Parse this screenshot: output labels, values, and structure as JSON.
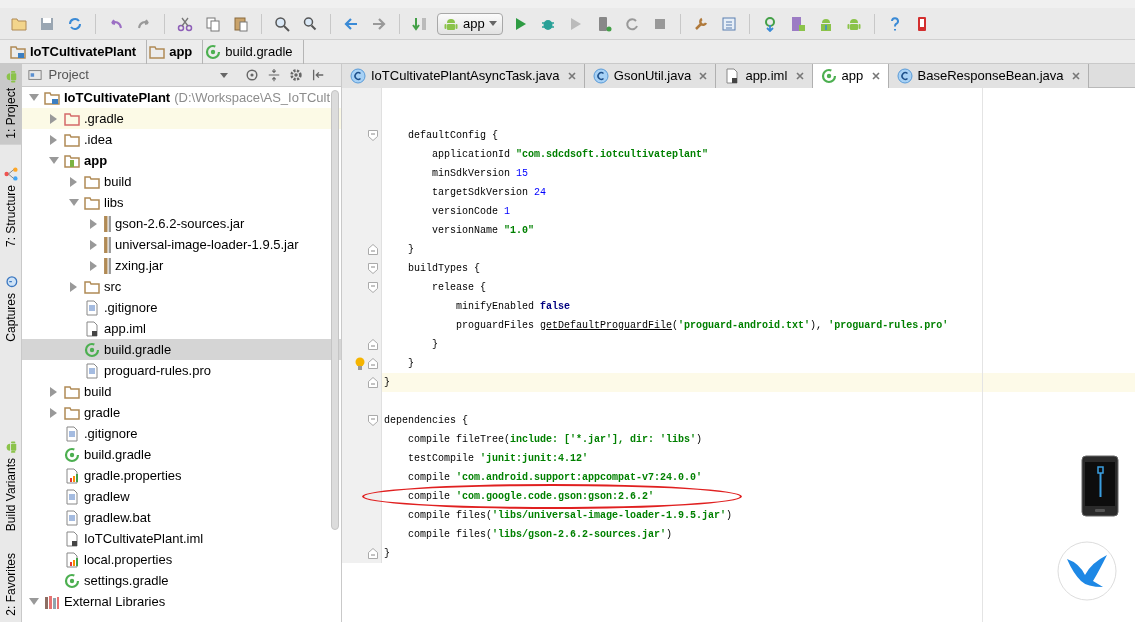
{
  "run_config": {
    "label": "app"
  },
  "breadcrumbs": [
    {
      "label": "IoTCultivatePlant",
      "kind": "project-folder",
      "bold": true
    },
    {
      "label": "app",
      "kind": "folder",
      "bold": true
    },
    {
      "label": "build.gradle",
      "kind": "gradle",
      "bold": false
    }
  ],
  "tool_windows": {
    "top": [
      {
        "label": "1: Project",
        "kind": "android",
        "selected": true
      },
      {
        "label": "7: Structure",
        "kind": "structure",
        "selected": false
      },
      {
        "label": "Captures",
        "kind": "stopwatch",
        "selected": false
      }
    ],
    "bottom": [
      {
        "label": "Build Variants",
        "kind": "android",
        "selected": false
      },
      {
        "label": "2: Favorites",
        "kind": "plain",
        "selected": false
      }
    ]
  },
  "project_panel": {
    "title": "Project",
    "tree": [
      {
        "label": "IoTCultivatePlant",
        "hint": "(D:\\Workspace\\AS_IoTCult",
        "kind": "project-folder",
        "bold": true,
        "expanded": true,
        "selected": false,
        "highlighted": false,
        "children": [
          {
            "label": ".gradle",
            "kind": "folder-excluded",
            "bold": false,
            "expanded": false,
            "selected": false,
            "highlighted": true
          },
          {
            "label": ".idea",
            "kind": "folder",
            "bold": false,
            "expanded": false,
            "selected": false,
            "highlighted": false
          },
          {
            "label": "app",
            "kind": "module-folder",
            "bold": true,
            "expanded": true,
            "selected": false,
            "highlighted": false,
            "children": [
              {
                "label": "build",
                "kind": "folder",
                "bold": false,
                "expanded": false,
                "selected": false,
                "highlighted": false
              },
              {
                "label": "libs",
                "kind": "folder",
                "bold": false,
                "expanded": true,
                "selected": false,
                "highlighted": false,
                "children": [
                  {
                    "label": "gson-2.6.2-sources.jar",
                    "kind": "jar",
                    "bold": false,
                    "expanded": false,
                    "selected": false,
                    "highlighted": false
                  },
                  {
                    "label": "universal-image-loader-1.9.5.jar",
                    "kind": "jar",
                    "bold": false,
                    "expanded": false,
                    "selected": false,
                    "highlighted": false
                  },
                  {
                    "label": "zxing.jar",
                    "kind": "jar",
                    "bold": false,
                    "expanded": false,
                    "selected": false,
                    "highlighted": false
                  }
                ]
              },
              {
                "label": "src",
                "kind": "folder",
                "bold": false,
                "expanded": false,
                "selected": false,
                "highlighted": false
              },
              {
                "label": ".gitignore",
                "kind": "text-file",
                "bold": false,
                "selected": false,
                "highlighted": false
              },
              {
                "label": "app.iml",
                "kind": "iml-file",
                "bold": false,
                "selected": false,
                "highlighted": false
              },
              {
                "label": "build.gradle",
                "kind": "gradle",
                "bold": false,
                "selected": true,
                "highlighted": false
              },
              {
                "label": "proguard-rules.pro",
                "kind": "text-file",
                "bold": false,
                "selected": false,
                "highlighted": false
              }
            ]
          },
          {
            "label": "build",
            "kind": "folder",
            "bold": false,
            "expanded": false,
            "selected": false,
            "highlighted": false
          },
          {
            "label": "gradle",
            "kind": "folder",
            "bold": false,
            "expanded": false,
            "selected": false,
            "highlighted": false
          },
          {
            "label": ".gitignore",
            "kind": "text-file",
            "bold": false,
            "selected": false,
            "highlighted": false
          },
          {
            "label": "build.gradle",
            "kind": "gradle",
            "bold": false,
            "selected": false,
            "highlighted": false
          },
          {
            "label": "gradle.properties",
            "kind": "properties-file",
            "bold": false,
            "selected": false,
            "highlighted": false
          },
          {
            "label": "gradlew",
            "kind": "text-file",
            "bold": false,
            "selected": false,
            "highlighted": false
          },
          {
            "label": "gradlew.bat",
            "kind": "text-file",
            "bold": false,
            "selected": false,
            "highlighted": false
          },
          {
            "label": "IoTCultivatePlant.iml",
            "kind": "iml-file",
            "bold": false,
            "selected": false,
            "highlighted": false
          },
          {
            "label": "local.properties",
            "kind": "properties-file",
            "bold": false,
            "selected": false,
            "highlighted": false
          },
          {
            "label": "settings.gradle",
            "kind": "gradle",
            "bold": false,
            "selected": false,
            "highlighted": false
          }
        ]
      },
      {
        "label": "External Libraries",
        "kind": "libraries",
        "bold": false,
        "expanded": true,
        "selected": false,
        "highlighted": false
      }
    ]
  },
  "editor_tabs": [
    {
      "label": "IoTCultivatePlantAsyncTask.java",
      "kind": "class",
      "selected": false
    },
    {
      "label": "GsonUtil.java",
      "kind": "class",
      "selected": false
    },
    {
      "label": "app.iml",
      "kind": "iml-file",
      "selected": false
    },
    {
      "label": "app",
      "kind": "gradle",
      "selected": true
    },
    {
      "label": "BaseResponseBean.java",
      "kind": "class",
      "selected": false
    }
  ],
  "code_lines": [
    {
      "kind": "blank"
    },
    {
      "kind": "blank"
    },
    {
      "kind": "fold-start",
      "segments": [
        {
          "kind": "plain",
          "text": "    defaultConfig {"
        }
      ]
    },
    {
      "kind": "plain",
      "segments": [
        {
          "kind": "plain",
          "text": "        applicationId "
        },
        {
          "kind": "string",
          "text": "\"com.sdcdsoft.iotcultivateplant\""
        }
      ]
    },
    {
      "kind": "plain",
      "segments": [
        {
          "kind": "plain",
          "text": "        minSdkVersion "
        },
        {
          "kind": "number",
          "text": "15"
        }
      ]
    },
    {
      "kind": "plain",
      "segments": [
        {
          "kind": "plain",
          "text": "        targetSdkVersion "
        },
        {
          "kind": "number",
          "text": "24"
        }
      ]
    },
    {
      "kind": "plain",
      "segments": [
        {
          "kind": "plain",
          "text": "        versionCode "
        },
        {
          "kind": "number",
          "text": "1"
        }
      ]
    },
    {
      "kind": "plain",
      "segments": [
        {
          "kind": "plain",
          "text": "        versionName "
        },
        {
          "kind": "string",
          "text": "\"1.0\""
        }
      ]
    },
    {
      "kind": "fold-end",
      "segments": [
        {
          "kind": "plain",
          "text": "    }"
        }
      ]
    },
    {
      "kind": "fold-start",
      "segments": [
        {
          "kind": "plain",
          "text": "    buildTypes {"
        }
      ]
    },
    {
      "kind": "fold-start",
      "segments": [
        {
          "kind": "plain",
          "text": "        release {"
        }
      ]
    },
    {
      "kind": "plain",
      "segments": [
        {
          "kind": "plain",
          "text": "            minifyEnabled "
        },
        {
          "kind": "keyword",
          "text": "false"
        }
      ]
    },
    {
      "kind": "plain",
      "segments": [
        {
          "kind": "plain",
          "text": "            proguardFiles "
        },
        {
          "kind": "method",
          "text": "getDefaultProguardFile"
        },
        {
          "kind": "plain",
          "text": "("
        },
        {
          "kind": "string",
          "text": "'proguard-android.txt'"
        },
        {
          "kind": "plain",
          "text": "), "
        },
        {
          "kind": "string",
          "text": "'proguard-rules.pro'"
        }
      ]
    },
    {
      "kind": "fold-end",
      "segments": [
        {
          "kind": "plain",
          "text": "        }"
        }
      ]
    },
    {
      "kind": "fold-end",
      "bulb": true,
      "segments": [
        {
          "kind": "plain",
          "text": "    }"
        }
      ]
    },
    {
      "kind": "fold-end",
      "current": true,
      "segments": [
        {
          "kind": "plain",
          "text": "}"
        }
      ]
    },
    {
      "kind": "blank"
    },
    {
      "kind": "fold-start",
      "segments": [
        {
          "kind": "plain",
          "text": "dependencies {"
        }
      ]
    },
    {
      "kind": "plain",
      "segments": [
        {
          "kind": "plain",
          "text": "    compile fileTree("
        },
        {
          "kind": "string",
          "text": "include: ['*.jar'], dir: 'libs'"
        },
        {
          "kind": "plain",
          "text": ")"
        }
      ]
    },
    {
      "kind": "plain",
      "segments": [
        {
          "kind": "plain",
          "text": "    testCompile "
        },
        {
          "kind": "string",
          "text": "'junit:junit:4.12'"
        }
      ]
    },
    {
      "kind": "plain",
      "segments": [
        {
          "kind": "plain",
          "text": "    compile "
        },
        {
          "kind": "string",
          "text": "'com.android.support:appcompat-v7:24.0.0'"
        }
      ]
    },
    {
      "kind": "plain",
      "circled": true,
      "segments": [
        {
          "kind": "plain",
          "text": "    compile "
        },
        {
          "kind": "string",
          "text": "'com.google.code.gson:gson:2.6.2'"
        }
      ]
    },
    {
      "kind": "plain",
      "segments": [
        {
          "kind": "plain",
          "text": "    compile files("
        },
        {
          "kind": "string",
          "text": "'libs/universal-image-loader-1.9.5.jar'"
        },
        {
          "kind": "plain",
          "text": ")"
        }
      ]
    },
    {
      "kind": "plain",
      "segments": [
        {
          "kind": "plain",
          "text": "    compile files("
        },
        {
          "kind": "string",
          "text": "'libs/gson-2.6.2-sources.jar'"
        },
        {
          "kind": "plain",
          "text": ")"
        }
      ]
    },
    {
      "kind": "fold-end",
      "segments": [
        {
          "kind": "plain",
          "text": "}"
        }
      ]
    }
  ]
}
